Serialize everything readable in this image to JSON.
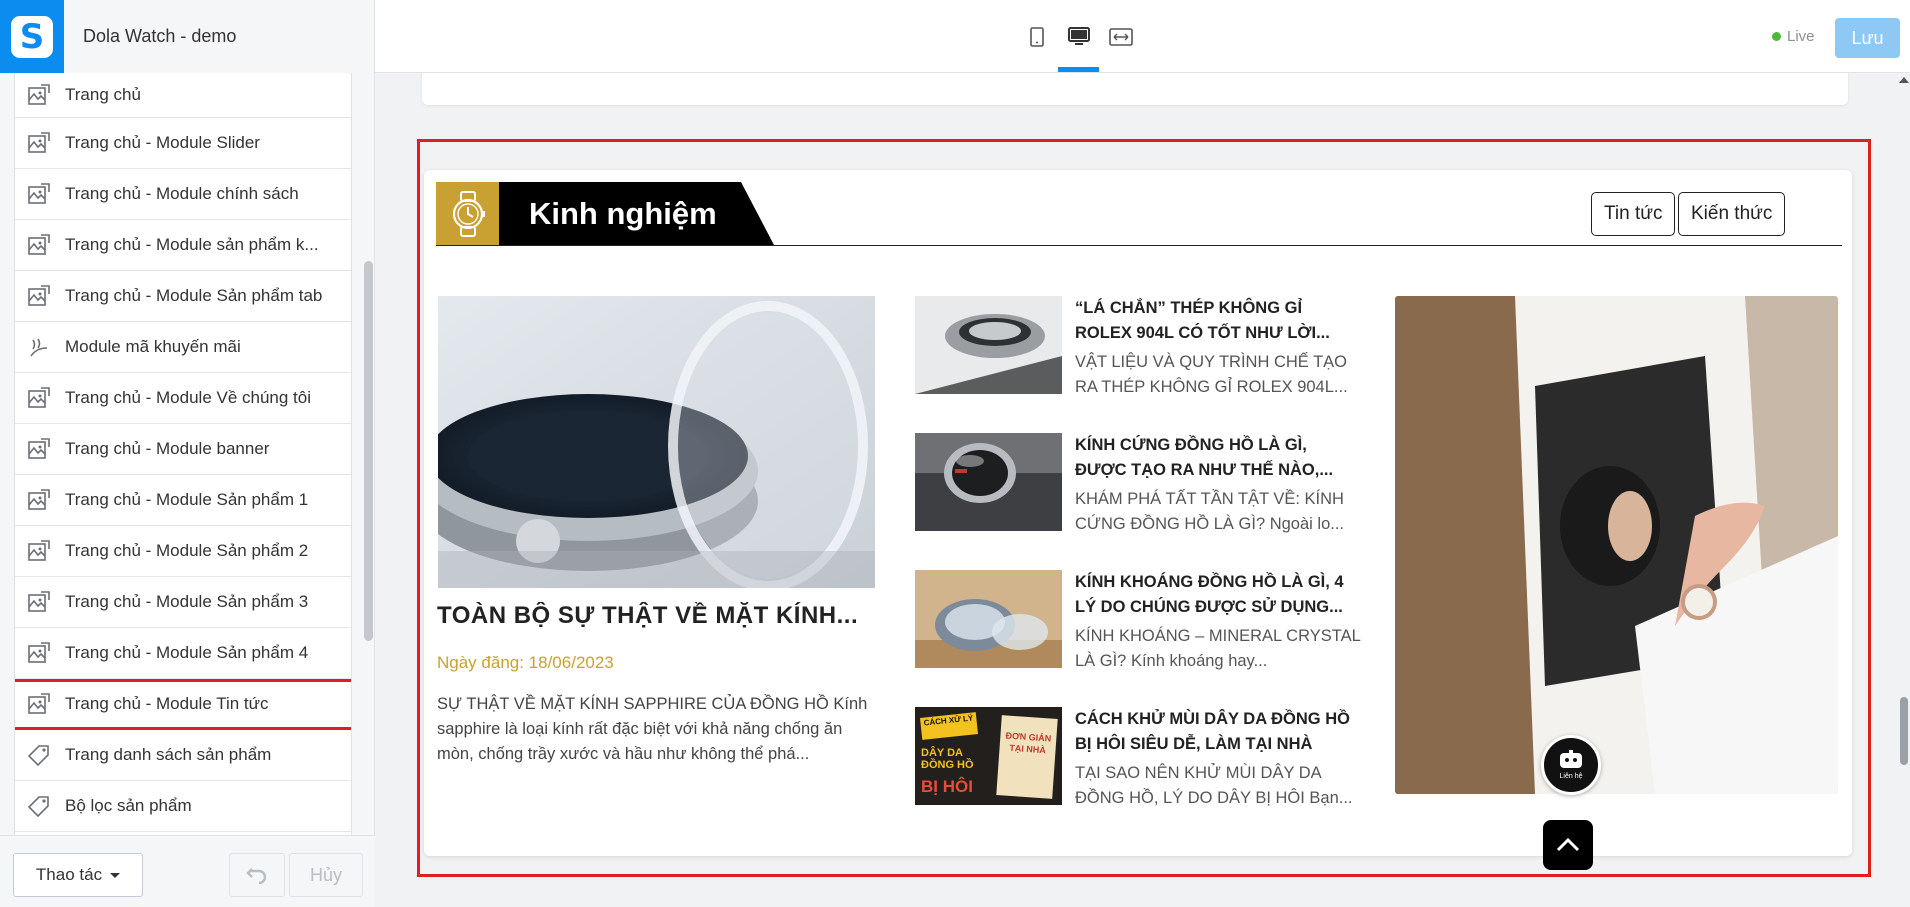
{
  "header": {
    "store_title": "Dola Watch - demo",
    "live_label": "Live",
    "save_label": "Lưu",
    "devices": [
      "mobile-icon",
      "desktop-icon",
      "fullwidth-icon"
    ],
    "active_device": "desktop"
  },
  "sidebar": {
    "items": [
      {
        "label": "Trang chủ",
        "icon": "layout-icon"
      },
      {
        "label": "Trang chủ - Module Slider",
        "icon": "layout-icon"
      },
      {
        "label": "Trang chủ - Module chính sách",
        "icon": "layout-icon"
      },
      {
        "label": "Trang chủ - Module sản phẩm k...",
        "icon": "layout-icon"
      },
      {
        "label": "Trang chủ - Module Sản phẩm tab",
        "icon": "layout-icon"
      },
      {
        "label": "Module mã khuyến mãi",
        "icon": "promo-icon"
      },
      {
        "label": "Trang chủ - Module Về chúng tôi",
        "icon": "layout-icon"
      },
      {
        "label": "Trang chủ - Module banner",
        "icon": "layout-icon"
      },
      {
        "label": "Trang chủ - Module Sản phẩm 1",
        "icon": "layout-icon"
      },
      {
        "label": "Trang chủ - Module Sản phẩm 2",
        "icon": "layout-icon"
      },
      {
        "label": "Trang chủ - Module Sản phẩm 3",
        "icon": "layout-icon"
      },
      {
        "label": "Trang chủ - Module Sản phẩm 4",
        "icon": "layout-icon"
      },
      {
        "label": "Trang chủ - Module Tin tức",
        "icon": "layout-icon",
        "highlighted": true
      },
      {
        "label": "Trang danh sách sản phẩm",
        "icon": "tag-icon"
      },
      {
        "label": "Bộ lọc sản phẩm",
        "icon": "tag-icon"
      }
    ],
    "actions_label": "Thao tác",
    "cancel_label": "Hủy"
  },
  "preview": {
    "section_title": "Kinh nghiệm",
    "tabs": [
      "Tin tức",
      "Kiến thức"
    ],
    "featured": {
      "title": "TOÀN BỘ SỰ THẬT VỀ MẶT KÍNH...",
      "date": "Ngày đăng: 18/06/2023",
      "desc": "SỰ THẬT VỀ MẶT KÍNH SAPPHIRE CỦA ĐỒNG HỒ Kính sapphire là loại kính rất đặc biệt với khả năng chống ăn mòn, chống trầy xước và hầu như không thể phá..."
    },
    "articles": [
      {
        "title": "“LÁ CHẮN” THÉP KHÔNG GỈ ROLEX 904L CÓ TỐT NHƯ LỜI...",
        "desc": "VẬT LIỆU VÀ QUY TRÌNH CHẾ TẠO RA THÉP KHÔNG GỈ ROLEX 904L..."
      },
      {
        "title": "KÍNH CỨNG ĐỒNG HỒ LÀ GÌ, ĐƯỢC TẠO RA NHƯ THẾ NÀO,...",
        "desc": "KHÁM PHÁ TẤT TẦN TẬT VỀ: KÍNH CỨNG ĐỒNG HỒ LÀ GÌ? Ngoài lo..."
      },
      {
        "title": "KÍNH KHOÁNG ĐỒNG HỒ LÀ GÌ, 4 LÝ DO CHÚNG ĐƯỢC SỬ DỤNG...",
        "desc": "KÍNH KHOÁNG – MINERAL CRYSTAL LÀ GÌ? Kính khoáng hay..."
      },
      {
        "title": "CÁCH KHỬ MÙI DÂY DA ĐỒNG HỒ BỊ HÔI SIÊU DỄ, LÀM TẠI NHÀ",
        "desc": "TẠI SAO NÊN KHỬ MÙI DÂY DA ĐỒNG HỒ, LÝ DO DÂY BỊ HÔI Bạn..."
      }
    ],
    "thumb4_text": {
      "a": "CÁCH XỬ LÝ",
      "b": "DÂY DA ĐỒNG HỒ",
      "c": "BỊ HÔI",
      "d": "ĐƠN GIẢN TẠI NHÀ"
    },
    "chat_label": "Liên hệ"
  }
}
